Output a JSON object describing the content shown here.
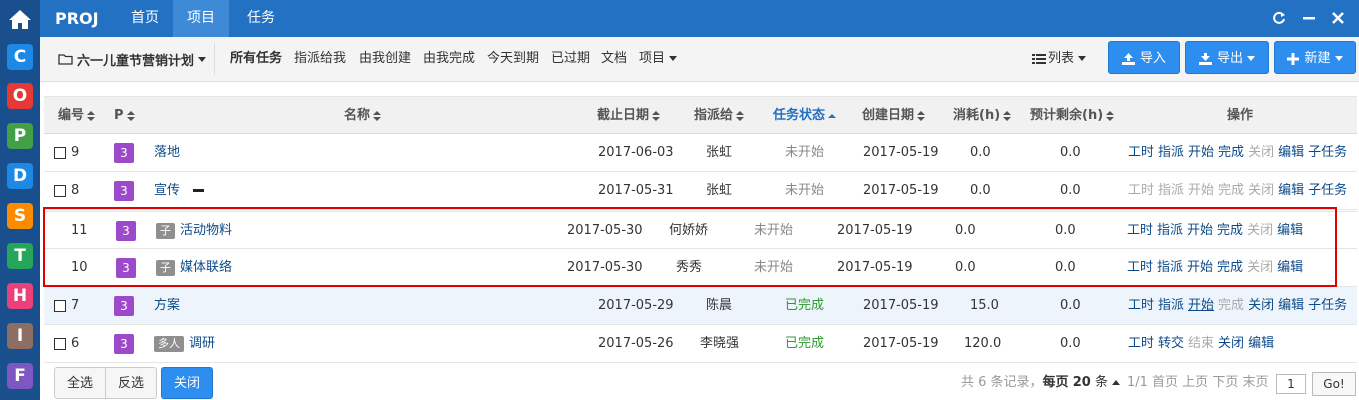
{
  "leftbar": {
    "apps": [
      {
        "letter": "C",
        "color": "#1e88e5"
      },
      {
        "letter": "O",
        "color": "#e53935"
      },
      {
        "letter": "P",
        "color": "#43a047"
      },
      {
        "letter": "D",
        "color": "#1e88e5"
      },
      {
        "letter": "S",
        "color": "#fb8c00"
      },
      {
        "letter": "T",
        "color": "#26a65b"
      },
      {
        "letter": "H",
        "color": "#ec407a"
      },
      {
        "letter": "I",
        "color": "#8d6e63"
      },
      {
        "letter": "F",
        "color": "#7e57c2"
      }
    ]
  },
  "topbar": {
    "brand": "PROJ",
    "nav": [
      "首页",
      "项目",
      "任务"
    ],
    "active_nav": "项目"
  },
  "subbar": {
    "project": "六一儿童节营销计划",
    "filters": [
      "所有任务",
      "指派给我",
      "由我创建",
      "由我完成",
      "今天到期",
      "已过期",
      "文档",
      "项目"
    ],
    "view": "列表",
    "import": "导入",
    "export": "导出",
    "create": "新建"
  },
  "table": {
    "headers": {
      "id": "编号",
      "pri": "P",
      "name": "名称",
      "deadline": "截止日期",
      "assignee": "指派给",
      "status": "任务状态",
      "created": "创建日期",
      "consumed": "消耗(h)",
      "left": "预计剩余(h)",
      "actions": "操作"
    },
    "rows": [
      {
        "id": "9",
        "pri": "3",
        "tag": "",
        "name": "落地",
        "deadline": "2017-06-03",
        "assignee": "张虹",
        "status": "未开始",
        "created": "2017-05-19",
        "consumed": "0.0",
        "left": "0.0",
        "actions": [
          "工时",
          "指派",
          "开始",
          "完成",
          "关闭",
          "编辑",
          "子任务"
        ]
      },
      {
        "id": "8",
        "pri": "3",
        "tag": "",
        "name": "宣传",
        "deadline": "2017-05-31",
        "assignee": "张虹",
        "status": "未开始",
        "created": "2017-05-19",
        "consumed": "0.0",
        "left": "0.0",
        "actions": [
          "工时",
          "指派",
          "开始",
          "完成",
          "关闭",
          "编辑",
          "子任务"
        ]
      },
      {
        "id": "11",
        "pri": "3",
        "tag": "子",
        "name": "活动物料",
        "deadline": "2017-05-30",
        "assignee": "何娇娇",
        "status": "未开始",
        "created": "2017-05-19",
        "consumed": "0.0",
        "left": "0.0",
        "actions": [
          "工时",
          "指派",
          "开始",
          "完成",
          "关闭",
          "编辑"
        ]
      },
      {
        "id": "10",
        "pri": "3",
        "tag": "子",
        "name": "媒体联络",
        "deadline": "2017-05-30",
        "assignee": "秀秀",
        "status": "未开始",
        "created": "2017-05-19",
        "consumed": "0.0",
        "left": "0.0",
        "actions": [
          "工时",
          "指派",
          "开始",
          "完成",
          "关闭",
          "编辑"
        ]
      },
      {
        "id": "7",
        "pri": "3",
        "tag": "",
        "name": "方案",
        "deadline": "2017-05-29",
        "assignee": "陈晨",
        "status": "已完成",
        "created": "2017-05-19",
        "consumed": "15.0",
        "left": "0.0",
        "actions": [
          "工时",
          "指派",
          "开始",
          "完成",
          "关闭",
          "编辑",
          "子任务"
        ]
      },
      {
        "id": "6",
        "pri": "3",
        "tag": "多人",
        "name": "调研",
        "deadline": "2017-05-26",
        "assignee": "李晓强",
        "status": "已完成",
        "created": "2017-05-19",
        "consumed": "120.0",
        "left": "0.0",
        "actions": [
          "工时",
          "转交",
          "结束",
          "关闭",
          "编辑"
        ]
      }
    ]
  },
  "footer": {
    "select_all": "全选",
    "invert": "反选",
    "close": "关闭",
    "pager_total": "共 6 条记录，",
    "pager_per_page_label": "每页",
    "pager_per_page": "20",
    "pager_unit": "条",
    "pager_page": "1/1",
    "pager_links": [
      "首页",
      "上页",
      "下页",
      "末页"
    ],
    "pager_input": "1",
    "go": "Go!"
  }
}
